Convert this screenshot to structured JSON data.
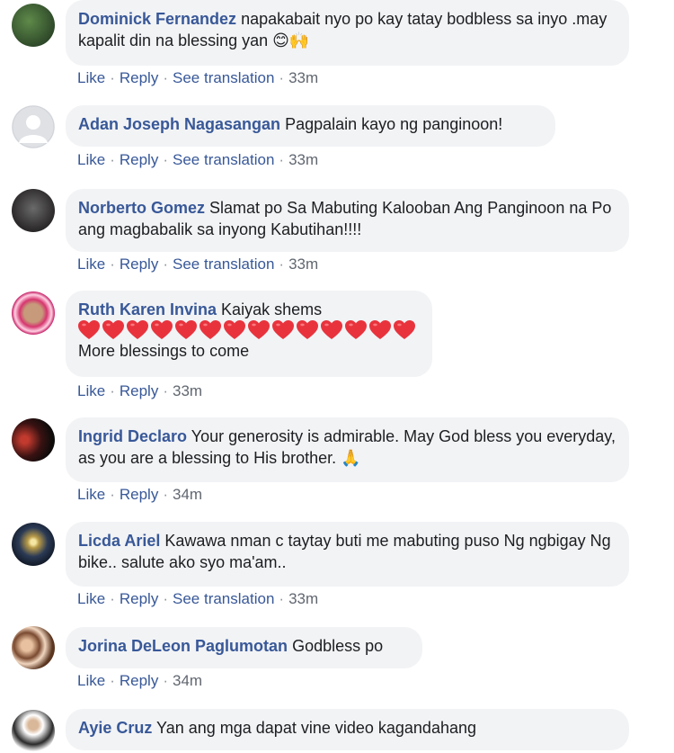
{
  "comments": [
    {
      "author": "Dominick Fernandez",
      "text": "napakabait nyo po kay tatay bodbless sa inyo .may kapalit din na blessing yan 😊🙌",
      "actions": [
        "Like",
        "Reply",
        "See translation"
      ],
      "time": "33m"
    },
    {
      "author": "Adan Joseph Nagasangan",
      "text": "Pagpalain kayo ng panginoon!",
      "actions": [
        "Like",
        "Reply",
        "See translation"
      ],
      "time": "33m"
    },
    {
      "author": "Norberto Gomez",
      "text": "Slamat po Sa Mabuting Kalooban Ang Panginoon na Po ang magbabalik sa inyong Kabutihan!!!!",
      "actions": [
        "Like",
        "Reply",
        "See translation"
      ],
      "time": "33m"
    },
    {
      "author": "Ruth Karen Invina",
      "text": "Kaiyak shems",
      "text2": "More blessings to come",
      "hearts": 14,
      "actions": [
        "Like",
        "Reply"
      ],
      "time": "33m"
    },
    {
      "author": "Ingrid Declaro",
      "text": "Your generosity is admirable. May God bless you everyday, as you are a blessing to His brother. 🙏",
      "actions": [
        "Like",
        "Reply"
      ],
      "time": "34m"
    },
    {
      "author": "Licda Ariel",
      "text": "Kawawa nman c taytay buti me mabuting puso Ng ngbigay Ng bike.. salute ako syo ma'am..",
      "actions": [
        "Like",
        "Reply",
        "See translation"
      ],
      "time": "33m"
    },
    {
      "author": "Jorina DeLeon Paglumotan",
      "text": "Godbless po",
      "actions": [
        "Like",
        "Reply"
      ],
      "time": "34m"
    },
    {
      "author": "Ayie Cruz",
      "text": "Yan ang mga dapat vine video kagandahang",
      "actions": [],
      "time": ""
    }
  ]
}
